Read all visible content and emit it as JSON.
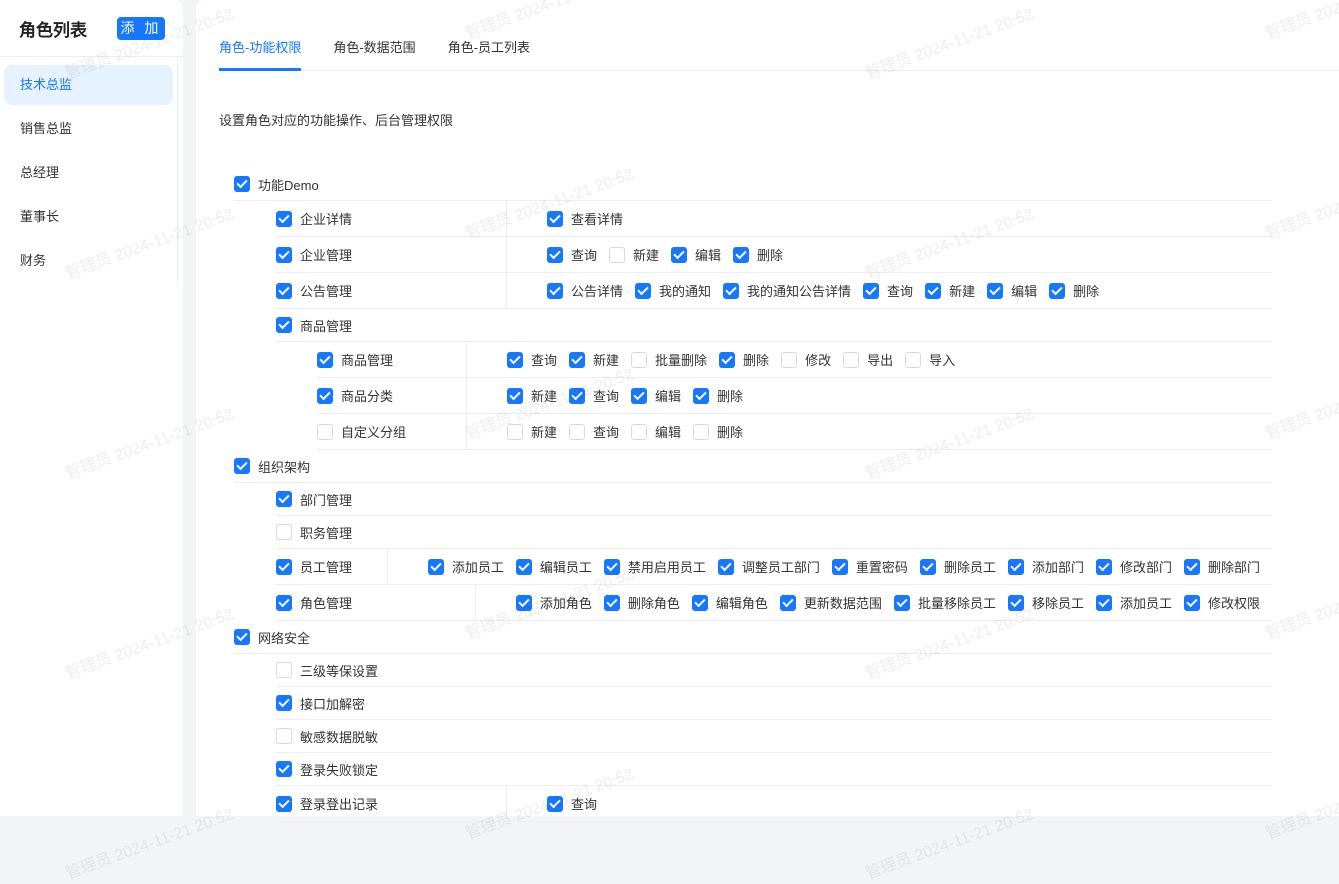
{
  "sidebar": {
    "title": "角色列表",
    "add_label": "添 加",
    "items": [
      {
        "label": "技术总监",
        "active": true
      },
      {
        "label": "销售总监"
      },
      {
        "label": "总经理"
      },
      {
        "label": "董事长"
      },
      {
        "label": "财务"
      }
    ]
  },
  "tabs": [
    {
      "label": "角色-功能权限",
      "active": true
    },
    {
      "label": "角色-数据范围"
    },
    {
      "label": "角色-员工列表"
    }
  ],
  "description": "设置角色对应的功能操作、后台管理权限",
  "watermark": "管理员 2024-11-21 20:52",
  "tree": [
    {
      "level": 1,
      "label": "功能Demo",
      "checked": true
    },
    {
      "level": 2,
      "label": "企业详情",
      "checked": true,
      "ops": [
        {
          "label": "查看详情",
          "checked": true
        }
      ]
    },
    {
      "level": 2,
      "label": "企业管理",
      "checked": true,
      "ops": [
        {
          "label": "查询",
          "checked": true
        },
        {
          "label": "新建",
          "checked": false
        },
        {
          "label": "编辑",
          "checked": true
        },
        {
          "label": "删除",
          "checked": true
        }
      ]
    },
    {
      "level": 2,
      "label": "公告管理",
      "checked": true,
      "ops": [
        {
          "label": "公告详情",
          "checked": true
        },
        {
          "label": "我的通知",
          "checked": true
        },
        {
          "label": "我的通知公告详情",
          "checked": true
        },
        {
          "label": "查询",
          "checked": true
        },
        {
          "label": "新建",
          "checked": true
        },
        {
          "label": "编辑",
          "checked": true
        },
        {
          "label": "删除",
          "checked": true
        }
      ]
    },
    {
      "level": 2,
      "label": "商品管理",
      "checked": true
    },
    {
      "level": 3,
      "label": "商品管理",
      "checked": true,
      "ops": [
        {
          "label": "查询",
          "checked": true
        },
        {
          "label": "新建",
          "checked": true
        },
        {
          "label": "批量删除",
          "checked": false
        },
        {
          "label": "删除",
          "checked": true
        },
        {
          "label": "修改",
          "checked": false
        },
        {
          "label": "导出",
          "checked": false
        },
        {
          "label": "导入",
          "checked": false
        }
      ]
    },
    {
      "level": 3,
      "label": "商品分类",
      "checked": true,
      "ops": [
        {
          "label": "新建",
          "checked": true
        },
        {
          "label": "查询",
          "checked": true
        },
        {
          "label": "编辑",
          "checked": true
        },
        {
          "label": "删除",
          "checked": true
        }
      ]
    },
    {
      "level": 3,
      "label": "自定义分组",
      "checked": false,
      "ops": [
        {
          "label": "新建",
          "checked": false
        },
        {
          "label": "查询",
          "checked": false
        },
        {
          "label": "编辑",
          "checked": false
        },
        {
          "label": "删除",
          "checked": false
        }
      ]
    },
    {
      "level": 1,
      "label": "组织架构",
      "checked": true
    },
    {
      "level": 2,
      "label": "部门管理",
      "checked": true
    },
    {
      "level": 2,
      "label": "职务管理",
      "checked": false
    },
    {
      "level": 2,
      "label": "员工管理",
      "checked": true,
      "ops": [
        {
          "label": "添加员工",
          "checked": true
        },
        {
          "label": "编辑员工",
          "checked": true
        },
        {
          "label": "禁用启用员工",
          "checked": true
        },
        {
          "label": "调整员工部门",
          "checked": true
        },
        {
          "label": "重置密码",
          "checked": true
        },
        {
          "label": "删除员工",
          "checked": true
        },
        {
          "label": "添加部门",
          "checked": true
        },
        {
          "label": "修改部门",
          "checked": true
        },
        {
          "label": "删除部门",
          "checked": true
        }
      ]
    },
    {
      "level": 2,
      "label": "角色管理",
      "checked": true,
      "ops": [
        {
          "label": "添加角色",
          "checked": true
        },
        {
          "label": "删除角色",
          "checked": true
        },
        {
          "label": "编辑角色",
          "checked": true
        },
        {
          "label": "更新数据范围",
          "checked": true
        },
        {
          "label": "批量移除员工",
          "checked": true
        },
        {
          "label": "移除员工",
          "checked": true
        },
        {
          "label": "添加员工",
          "checked": true
        },
        {
          "label": "修改权限",
          "checked": true
        }
      ]
    },
    {
      "level": 1,
      "label": "网络安全",
      "checked": true
    },
    {
      "level": 2,
      "label": "三级等保设置",
      "checked": false
    },
    {
      "level": 2,
      "label": "接口加解密",
      "checked": true
    },
    {
      "level": 2,
      "label": "敏感数据脱敏",
      "checked": false
    },
    {
      "level": 2,
      "label": "登录失败锁定",
      "checked": true
    },
    {
      "level": 2,
      "label": "登录登出记录",
      "checked": true,
      "ops": [
        {
          "label": "查询",
          "checked": true
        }
      ]
    }
  ]
}
